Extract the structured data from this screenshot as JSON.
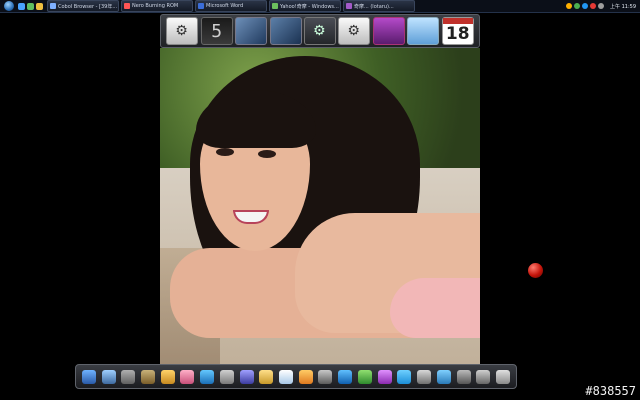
{
  "taskbar": {
    "tasks": [
      "Cobol Browser - [39年...",
      "Nero Burning ROM",
      "Microsoft Word",
      "Yahoo!奇摩 - Windows...",
      "奇摩... (lotaru)...",
      ""
    ],
    "clock": "上午 11:59"
  },
  "widgets": {
    "digit": "5",
    "calendar_day": "18"
  },
  "dock": {
    "icons": [
      "finder",
      "monitor",
      "doc",
      "folder",
      "media",
      "flower",
      "blue-app",
      "tools",
      "settings",
      "photos",
      "mail",
      "color",
      "search",
      "ie",
      "green",
      "messenger",
      "skype",
      "tools2",
      "globe",
      "utility",
      "cog",
      "trash"
    ]
  },
  "watermark": "#838557"
}
